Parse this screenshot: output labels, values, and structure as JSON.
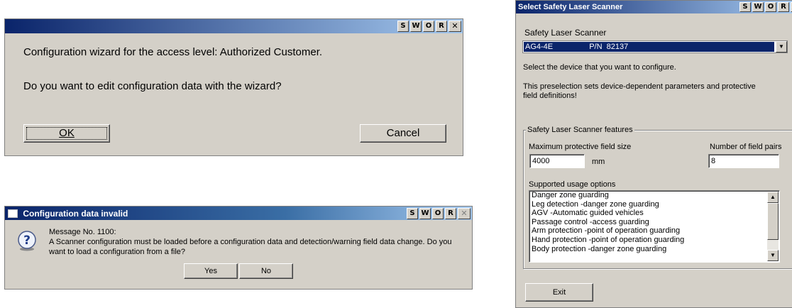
{
  "title_buttons": [
    "S",
    "W",
    "O",
    "R"
  ],
  "wizard": {
    "message1": "Configuration wizard for the access level: Authorized Customer.",
    "message2": "Do you want to edit configuration data with the wizard?",
    "ok_label": "OK",
    "cancel_label": "Cancel"
  },
  "invalid": {
    "title": "Configuration data invalid",
    "message_no": "Message No. 1100:",
    "message_line1": "A Scanner configuration must be loaded before a configuration data and detection/warning field data change. Do you",
    "message_line2": "want to load a configuration from a file?",
    "yes_label": "Yes",
    "no_label": "No",
    "icon": "question-icon"
  },
  "scanner": {
    "title": "Select Safety Laser Scanner",
    "scanner_label": "Safety Laser Scanner",
    "selected_device": "AG4-4E",
    "selected_pn": "P/N  82137",
    "instruction": "Select the device that you want to configure.",
    "note_line1": "This preselection sets device-dependent parameters and protective",
    "note_line2": "field definitions!",
    "features_label": "Safety Laser Scanner features",
    "max_field_label": "Maximum protective field size",
    "max_field_value": "4000",
    "max_field_unit": "mm",
    "field_pairs_label": "Number of field pairs",
    "field_pairs_value": "8",
    "usage_label": "Supported usage options",
    "usage_options": [
      "Danger zone guarding",
      "Leg detection  -danger zone guarding",
      "AGV  -Automatic guided vehicles",
      "Passage control  -access guarding",
      "Arm protection  -point of operation guarding",
      "Hand protection  -point of operation guarding",
      "Body protection  -danger zone guarding"
    ],
    "exit_label": "Exit"
  }
}
